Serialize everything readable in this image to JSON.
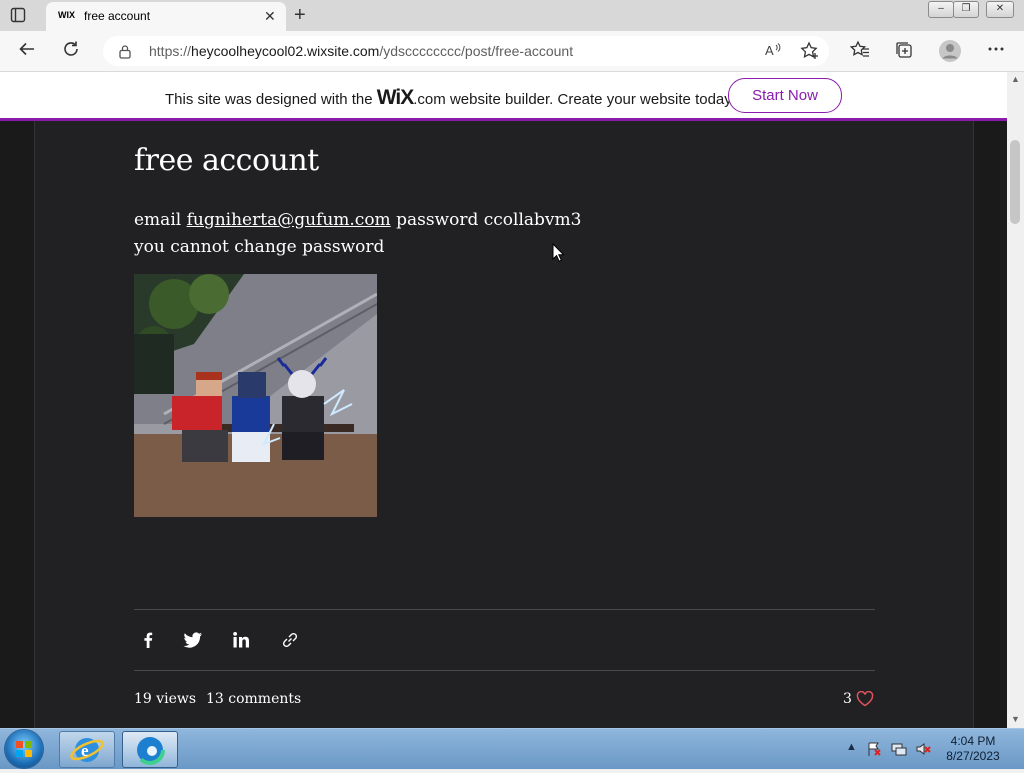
{
  "browser": {
    "tab": {
      "favicon": "WIX",
      "title": "free account",
      "close": "✕"
    },
    "new_tab": "+",
    "url": {
      "prefix": "https://",
      "host": "heycoolheycool02.wixsite.com",
      "path": "/ydscccccccc/post/free-account"
    },
    "icons": [
      "tab-actions-icon",
      "back-icon",
      "refresh-icon",
      "lock-icon",
      "read-aloud-icon",
      "add-favorite-icon",
      "favorites-icon",
      "collections-icon",
      "profile-icon",
      "more-icon"
    ],
    "window_controls": [
      "minimize-icon",
      "restore-icon",
      "close-icon"
    ]
  },
  "wix_banner": {
    "text_before": "This site was designed with the ",
    "logo": "WiX",
    "text_after": ".com website builder. Create your website today.",
    "button": "Start Now",
    "accent_color": "#8a1cab"
  },
  "post": {
    "title": "free account",
    "line1_prefix": "email ",
    "email": "fugniherta@gufum.com",
    "line1_suffix": " password ccollabvm3",
    "line2": "you cannot change password",
    "image_alt": "screenshot of three game avatars sitting on a bench",
    "share_icons": [
      "facebook-icon",
      "twitter-icon",
      "linkedin-icon",
      "link-icon"
    ],
    "views": "19 views",
    "comments": "13 comments",
    "likes": "3",
    "heart_color": "#e0535a"
  },
  "taskbar": {
    "pinned": [
      "internet-explorer-icon",
      "edge-icon"
    ],
    "tray_icons": [
      "show-hidden-icons",
      "action-center-flag-icon",
      "network-icon",
      "volume-muted-icon"
    ],
    "time": "4:04 PM",
    "date": "8/27/2023"
  }
}
